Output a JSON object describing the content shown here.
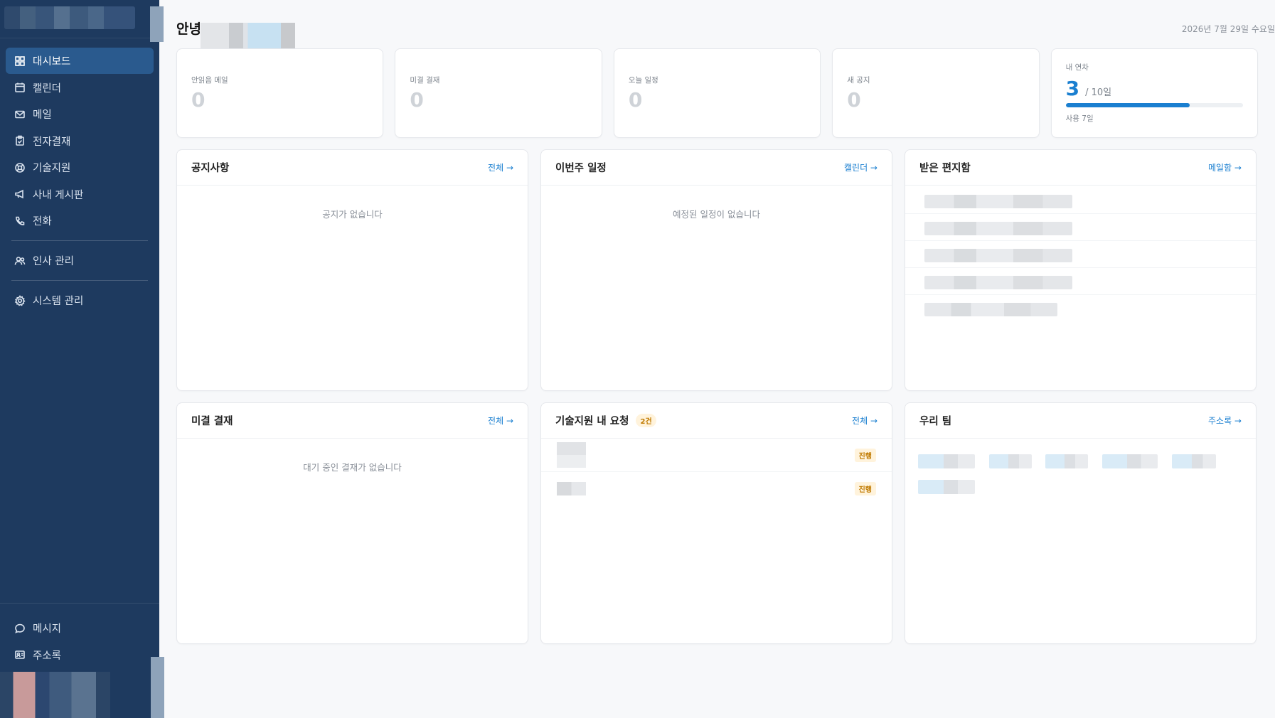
{
  "sidebar": {
    "nav": [
      {
        "label": "대시보드",
        "icon": "dashboard-icon",
        "active": true
      },
      {
        "label": "캘린더",
        "icon": "calendar-icon"
      },
      {
        "label": "메일",
        "icon": "mail-icon"
      },
      {
        "label": "전자결재",
        "icon": "clipboard-icon"
      },
      {
        "label": "기술지원",
        "icon": "lifebuoy-icon"
      },
      {
        "label": "사내 게시판",
        "icon": "megaphone-icon"
      },
      {
        "label": "전화",
        "icon": "phone-icon"
      }
    ],
    "admin": [
      {
        "label": "인사 관리",
        "icon": "users-icon"
      },
      {
        "label": "시스템 관리",
        "icon": "gear-icon"
      }
    ],
    "bottom": [
      {
        "label": "메시지",
        "icon": "message-icon"
      },
      {
        "label": "주소록",
        "icon": "contacts-icon"
      }
    ]
  },
  "header": {
    "greeting": "안녕",
    "date": "2026년 7월 29일 수요일"
  },
  "stats": [
    {
      "label": "안읽음 메일",
      "value": "0"
    },
    {
      "label": "미결 결재",
      "value": "0"
    },
    {
      "label": "오늘 일정",
      "value": "0"
    },
    {
      "label": "새 공지",
      "value": "0"
    }
  ],
  "leave": {
    "label": "내 연차",
    "used": "3",
    "total": "/ 10일",
    "progress": 0.7,
    "sub": "사용 7일"
  },
  "panels": {
    "notice": {
      "title": "공지사항",
      "link": "전체 →",
      "empty": "공지가 없습니다"
    },
    "schedule": {
      "title": "이번주 일정",
      "link": "캘린더 →",
      "empty": "예정된 일정이 없습니다"
    },
    "inbox": {
      "title": "받은 편지함",
      "link": "메일함 →"
    },
    "approval": {
      "title": "미결 결재",
      "link": "전체 →",
      "empty": "대기 중인 결재가 없습니다"
    },
    "support": {
      "title": "기술지원 내 요청",
      "badge": "2건",
      "link": "전체 →",
      "rows": [
        {
          "status": "진행"
        },
        {
          "status": "진행"
        }
      ]
    },
    "team": {
      "title": "우리 팀",
      "link": "주소록 →"
    }
  },
  "colors": {
    "sidebar": "#1e3a5f",
    "accent": "#1a7fd0",
    "active_nav": "#2a5a8e"
  }
}
